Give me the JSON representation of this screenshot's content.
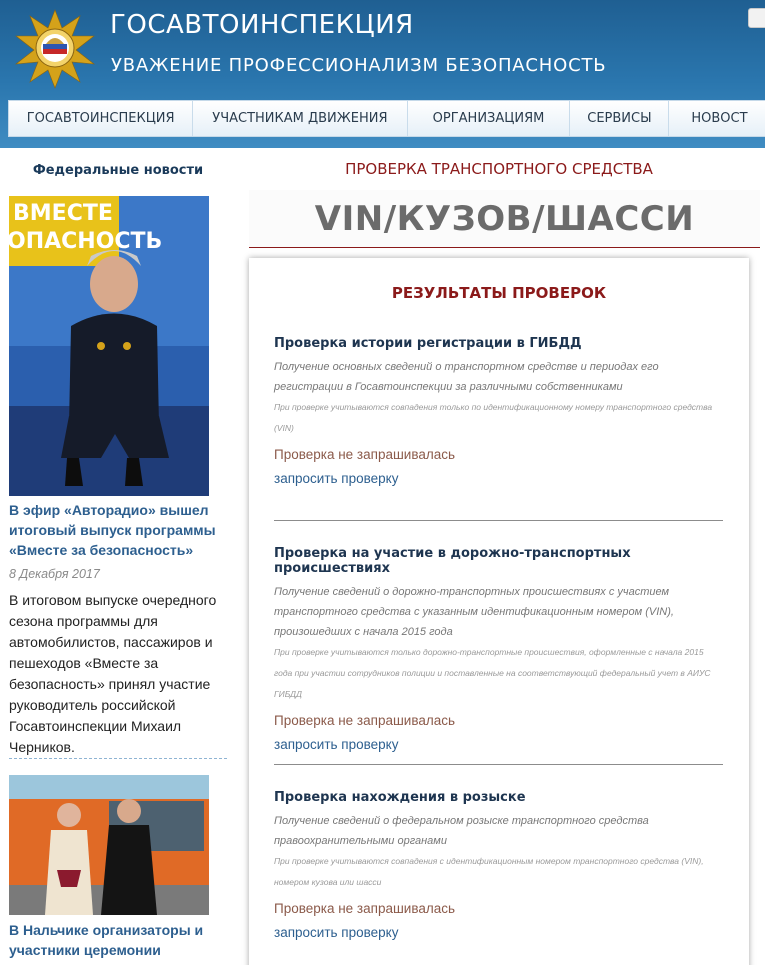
{
  "header": {
    "title": "ГОСАВТОИНСПЕКЦИЯ",
    "slogan": "УВАЖЕНИЕ  ПРОФЕССИОНАЛИЗМ  БЕЗОПАСНОСТЬ",
    "brand_color": "#2a76ae"
  },
  "nav": {
    "items": [
      {
        "label": "ГОСАВТОИНСПЕКЦИЯ"
      },
      {
        "label": "УЧАСТНИКАМ ДВИЖЕНИЯ"
      },
      {
        "label": "ОРГАНИЗАЦИЯМ"
      },
      {
        "label": "СЕРВИСЫ"
      },
      {
        "label": "НОВОСТ"
      }
    ]
  },
  "sidebar": {
    "heading": "Федеральные новости",
    "news": [
      {
        "photo_caption": "ВМЕСТЕ ОПАСНОСТЬ",
        "title": "В эфир «Авторадио» вышел итоговый выпуск программы «Вместе за безопасность»",
        "date": "8 Декабря 2017",
        "text": "В итоговом выпуске очередного сезона программы для автомобилистов, пассажиров и пешеходов «Вместе за безопасность» принял участие руководитель российской Госавтоинспекции Михаил Черников."
      },
      {
        "title": "В Нальчике организаторы и участники церемонии"
      }
    ]
  },
  "main": {
    "section_title": "ПРОВЕРКА ТРАНСПОРТНОГО СРЕДСТВА",
    "vin_title": "VIN/КУЗОВ/ШАССИ",
    "results_heading": "РЕЗУЛЬТАТЫ ПРОВЕРОК",
    "checks": [
      {
        "title": "Проверка истории регистрации в ГИБДД",
        "desc": "Получение основных сведений о транспортном средстве и периодах его регистрации в Госавтоинспекции за различными собственниками",
        "note": "При проверке учитываются совпадения только по идентификационному номеру транспортного средства (VIN)",
        "status": "Проверка не запрашивалась",
        "link": "запросить проверку"
      },
      {
        "title": "Проверка на участие в дорожно-транспортных происшествиях",
        "desc": "Получение сведений о дорожно-транспортных происшествиях с участием транспортного средства с указанным идентификационным номером (VIN), произошедших с начала 2015 года",
        "note": "При проверке учитываются только дорожно-транспортные происшествия, оформленные с начала 2015 года при участии сотрудников полиции и поставленные на соответствующий федеральный учет в АИУС ГИБДД",
        "status": "Проверка не запрашивалась",
        "link": "запросить проверку"
      },
      {
        "title": "Проверка нахождения в розыске",
        "desc": "Получение сведений о федеральном розыске транспортного средства правоохранительными органами",
        "note": "При проверке учитываются совпадения с идентификационным номером транспортного средства (VIN), номером кузова или шасси",
        "status": "Проверка не запрашивалась",
        "link": "запросить проверку"
      }
    ]
  }
}
